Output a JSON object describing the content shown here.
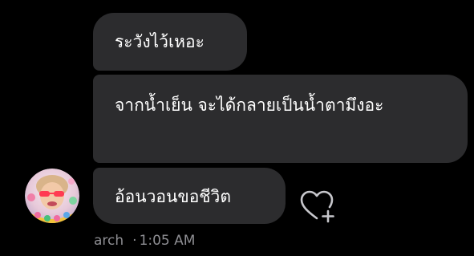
{
  "messages": [
    {
      "text": "ระวังไว้เหอะ"
    },
    {
      "text": "จากน้ำเย็น จะได้กลายเป็นน้ำตามึงอะ"
    },
    {
      "text": "อ้อนวอนขอชีวิต"
    }
  ],
  "sender": {
    "name": "arch",
    "time": "1:05 AM",
    "separator": "·"
  },
  "icons": {
    "reaction": "heart-plus-icon",
    "avatar": "user-avatar"
  },
  "colors": {
    "background": "#000000",
    "bubble": "#2c2c2e",
    "text": "#ffffff",
    "meta": "#8e8e93"
  }
}
